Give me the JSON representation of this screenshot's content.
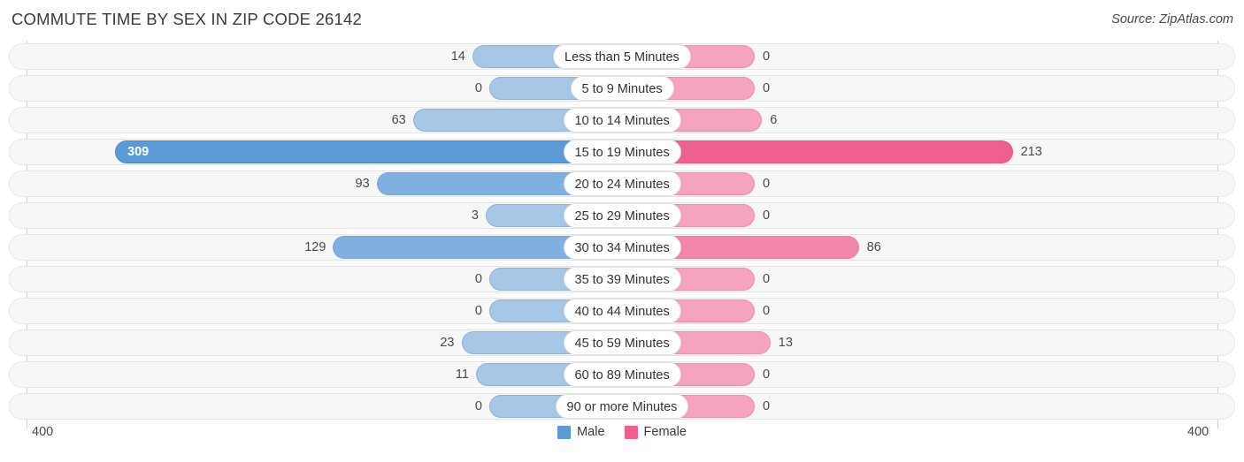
{
  "header": {
    "title": "COMMUTE TIME BY SEX IN ZIP CODE 26142",
    "source": "Source: ZipAtlas.com"
  },
  "axis": {
    "left_label": "400",
    "right_label": "400"
  },
  "legend": {
    "male_label": "Male",
    "female_label": "Female",
    "male_color": "#5b9bd5",
    "female_color": "#ef5f90"
  },
  "chart_data": {
    "type": "bar",
    "title": "COMMUTE TIME BY SEX IN ZIP CODE 26142",
    "subtitle": "Source: ZipAtlas.com",
    "orientation": "horizontal-diverging",
    "xlabel": "",
    "ylabel": "",
    "xlim": [
      400,
      400
    ],
    "axis_left_max": 400,
    "axis_right_max": 400,
    "grid": false,
    "legend_position": "bottom-center",
    "categories": [
      "Less than 5 Minutes",
      "5 to 9 Minutes",
      "10 to 14 Minutes",
      "15 to 19 Minutes",
      "20 to 24 Minutes",
      "25 to 29 Minutes",
      "30 to 34 Minutes",
      "35 to 39 Minutes",
      "40 to 44 Minutes",
      "45 to 59 Minutes",
      "60 to 89 Minutes",
      "90 or more Minutes"
    ],
    "series": [
      {
        "name": "Male",
        "color": "#5b9bd5",
        "values": [
          14,
          0,
          63,
          309,
          93,
          3,
          129,
          0,
          0,
          23,
          11,
          0
        ]
      },
      {
        "name": "Female",
        "color": "#ef5f90",
        "values": [
          0,
          0,
          6,
          213,
          0,
          0,
          86,
          0,
          0,
          13,
          0,
          0
        ]
      }
    ]
  }
}
